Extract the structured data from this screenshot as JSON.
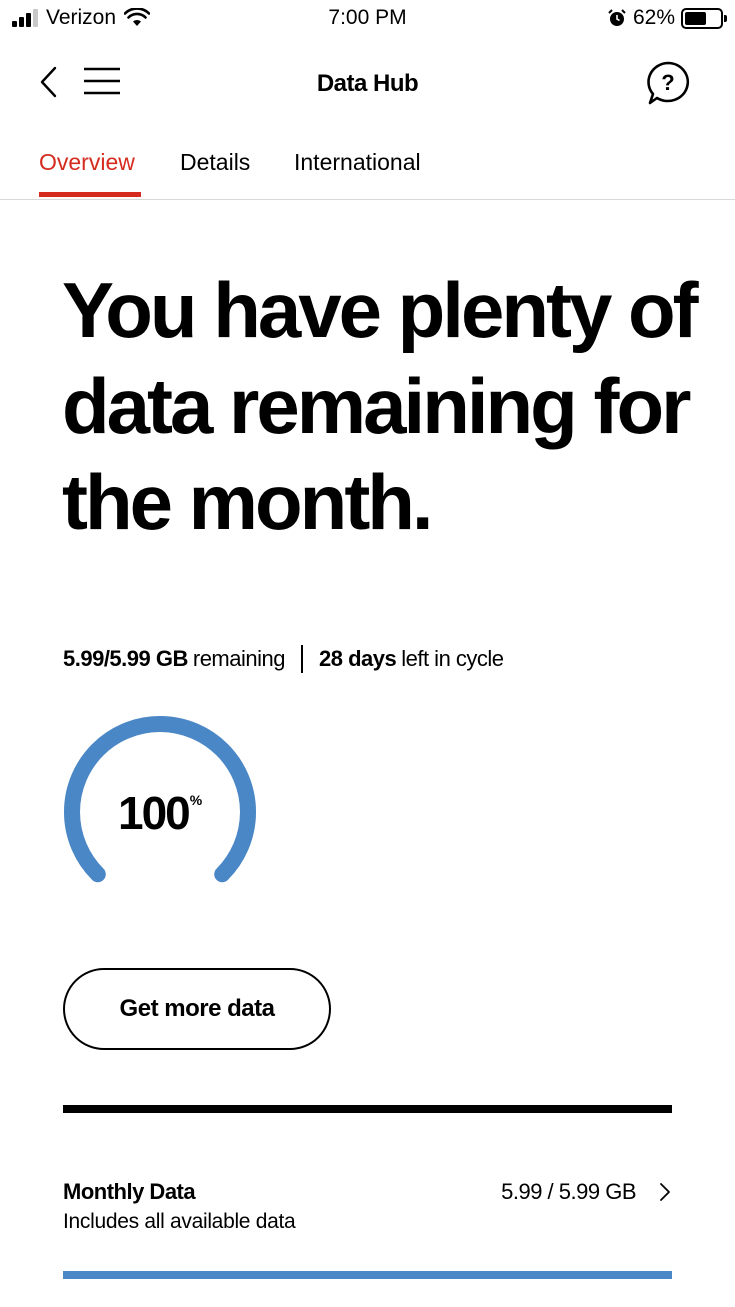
{
  "status_bar": {
    "carrier": "Verizon",
    "time": "7:00 PM",
    "battery_percent": "62%",
    "battery_level": 0.62,
    "icons": [
      "signal-icon",
      "wifi-icon",
      "alarm-icon",
      "battery-icon"
    ]
  },
  "nav": {
    "title": "Data Hub",
    "icons": [
      "back-chevron-icon",
      "hamburger-menu-icon",
      "help-chat-icon"
    ]
  },
  "tabs": [
    {
      "label": "Overview",
      "active": true
    },
    {
      "label": "Details",
      "active": false
    },
    {
      "label": "International",
      "active": false
    }
  ],
  "headline": "You have plenty of data remaining for the month.",
  "summary": {
    "data_amount": "5.99/5.99 GB",
    "data_suffix": "remaining",
    "days_amount": "28 days",
    "days_suffix": "left in cycle"
  },
  "gauge": {
    "value": "100",
    "unit": "%",
    "fraction": 1.0,
    "color": "#4a87c6"
  },
  "cta": {
    "label": "Get more data"
  },
  "monthly_data": {
    "title": "Monthly Data",
    "subtitle": "Includes all available data",
    "value": "5.99 / 5.99 GB",
    "progress_fraction": 1.0,
    "progress_color": "#4a87c6"
  },
  "colors": {
    "accent_red": "#d52b1e",
    "data_blue": "#4a87c6"
  }
}
